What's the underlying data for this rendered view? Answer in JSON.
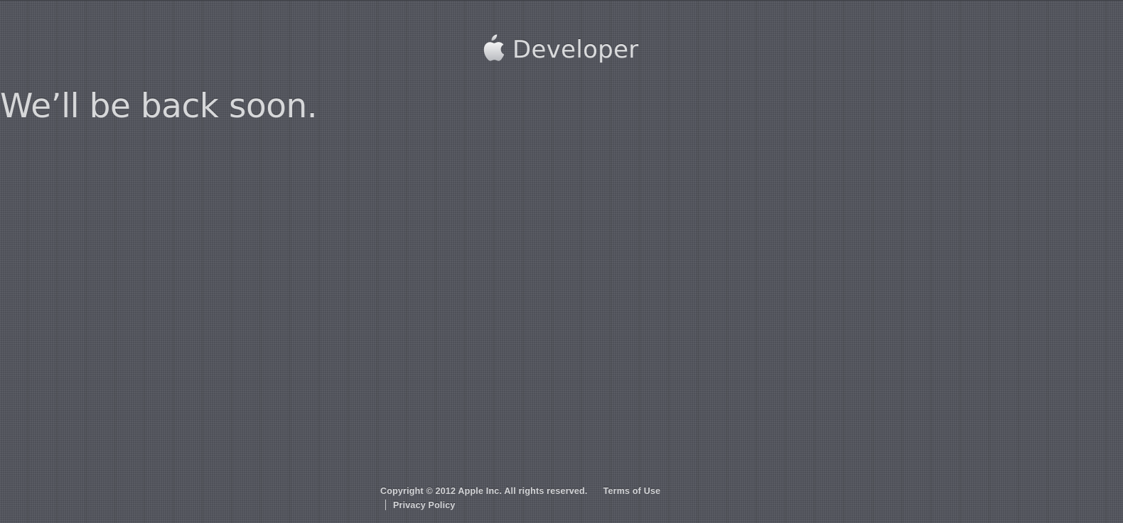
{
  "header": {
    "logo_icon": "apple-logo-icon",
    "title": "Developer"
  },
  "main": {
    "headline": "We’ll be back soon."
  },
  "footer": {
    "copyright": "Copyright © 2012 Apple Inc. All rights reserved.",
    "terms_label": "Terms of Use",
    "privacy_label": "Privacy Policy"
  },
  "colors": {
    "background": "#54565e",
    "text": "#d7d8da"
  }
}
